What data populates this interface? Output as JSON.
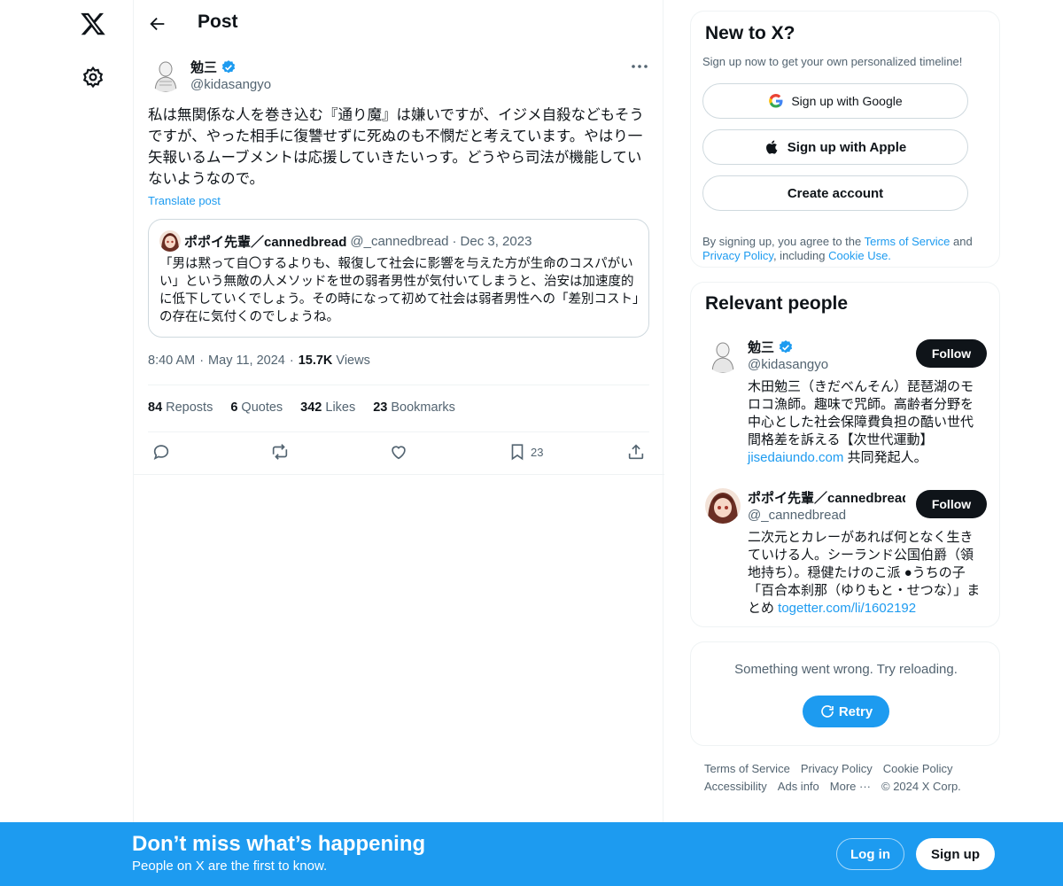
{
  "nav": {
    "logo_icon": "x-logo-icon",
    "settings_icon": "gear-icon"
  },
  "header": {
    "title": "Post"
  },
  "post": {
    "author_name": "勉三",
    "author_handle": "@kidasangyo",
    "text": "私は無関係な人を巻き込む『通り魔』は嫌いですが、イジメ自殺などもそうですが、やった相手に復讐せずに死ぬのも不憫だと考えています。やはり一矢報いるムーブメントは応援していきたいっす。どうやら司法が機能していないようなので。",
    "translate_label": "Translate post",
    "quote": {
      "name": "ポポイ先輩／cannedbread",
      "handle": "@_cannedbread",
      "date": "Dec 3, 2023",
      "text": "「男は黙って自〇するよりも、報復して社会に影響を与えた方が生命のコスパがいい」という無敵の人メソッドを世の弱者男性が気付いてしまうと、治安は加速度的に低下していくでしょう。その時になって初めて社会は弱者男性への「差別コスト」の存在に気付くのでしょうね。"
    },
    "time": "8:40 AM",
    "date": "May 11, 2024",
    "views_count": "15.7K",
    "views_label": "Views",
    "stats": {
      "reposts_count": "84",
      "reposts_label": "Reposts",
      "quotes_count": "6",
      "quotes_label": "Quotes",
      "likes_count": "342",
      "likes_label": "Likes",
      "bookmarks_count": "23",
      "bookmarks_label": "Bookmarks"
    },
    "bookmark_action_count": "23"
  },
  "signup_card": {
    "title": "New to X?",
    "subtitle": "Sign up now to get your own personalized timeline!",
    "google_label": "Sign up with Google",
    "apple_label": "Sign up with Apple",
    "create_label": "Create account",
    "legal_prefix": "By signing up, you agree to the ",
    "terms_label": "Terms of Service",
    "and_label": " and ",
    "privacy_label": "Privacy Policy",
    "including_label": ", including ",
    "cookie_label": "Cookie Use."
  },
  "relevant": {
    "title": "Relevant people",
    "people": [
      {
        "name": "勉三",
        "handle": "@kidasangyo",
        "follow_label": "Follow",
        "bio": "木田勉三（きだべんそん）琵琶湖のモロコ漁師。趣味で咒師。高齢者分野を中心とした社会保障費負担の酷い世代間格差を訴える【次世代運動】",
        "bio_link": "jisedaiundo.com",
        "bio_suffix": " 共同発起人。"
      },
      {
        "name": "ポポイ先輩／cannedbread",
        "handle": "@_cannedbread",
        "follow_label": "Follow",
        "bio": "二次元とカレーがあれば何となく生きていける人。シーランド公国伯爵（領地持ち）。穏健たけのこ派 ●うちの子「百合本刹那（ゆりもと・せつな）」まとめ ",
        "bio_link": "togetter.com/li/1602192"
      }
    ]
  },
  "error_card": {
    "message": "Something went wrong. Try reloading.",
    "retry_label": "Retry"
  },
  "footer": {
    "links": [
      "Terms of Service",
      "Privacy Policy",
      "Cookie Policy",
      "Accessibility",
      "Ads info",
      "More ···"
    ],
    "copyright": "© 2024 X Corp."
  },
  "banner": {
    "title": "Don’t miss what’s happening",
    "subtitle": "People on X are the first to know.",
    "login_label": "Log in",
    "signup_label": "Sign up"
  },
  "colors": {
    "accent": "#1d9bf0",
    "text": "#0f1419",
    "muted": "#536471",
    "border": "#eff3f4"
  }
}
